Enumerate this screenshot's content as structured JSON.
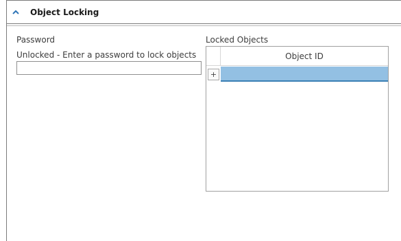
{
  "section": {
    "title": "Object Locking"
  },
  "password": {
    "label": "Password",
    "status": "Unlocked - Enter a password to lock objects",
    "value": ""
  },
  "locked_objects": {
    "label": "Locked Objects",
    "columns": [
      "Object ID"
    ],
    "add_label": "+",
    "rows": [
      {
        "object_id": ""
      }
    ]
  },
  "colors": {
    "selected_row": "#93c0e3",
    "selected_row_border": "#3a7fb5",
    "header_caret": "#2e75b6"
  },
  "icons": {
    "collapse": "chevron-up-icon"
  }
}
